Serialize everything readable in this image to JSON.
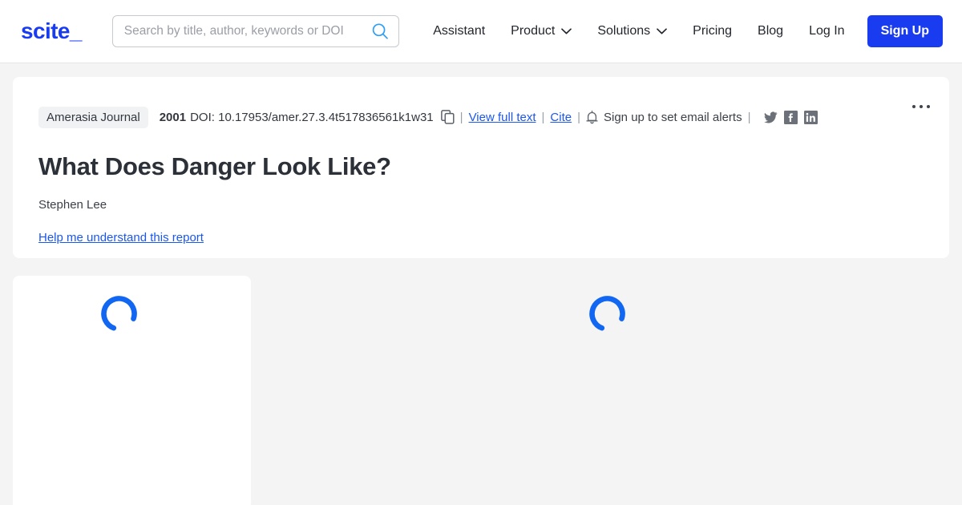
{
  "header": {
    "logo_text": "scite_",
    "search": {
      "placeholder": "Search by title, author, keywords or DOI",
      "value": "",
      "icon": "search-icon"
    },
    "nav": [
      {
        "label": "Assistant",
        "has_dropdown": false
      },
      {
        "label": "Product",
        "has_dropdown": true
      },
      {
        "label": "Solutions",
        "has_dropdown": true
      },
      {
        "label": "Pricing",
        "has_dropdown": false
      },
      {
        "label": "Blog",
        "has_dropdown": false
      },
      {
        "label": "Log In",
        "has_dropdown": false
      }
    ],
    "signup_label": "Sign Up"
  },
  "paper": {
    "journal": "Amerasia Journal",
    "year": "2001",
    "doi_label": "DOI: 10.17953/amer.27.3.4t517836561k1w31",
    "copy_icon": "copy-icon",
    "view_full_text_label": "View full text",
    "cite_label": "Cite",
    "bell_icon": "bell-icon",
    "alerts_label": "Sign up to set email alerts",
    "separator": "|",
    "socials": [
      {
        "name": "twitter-icon",
        "label": "Twitter"
      },
      {
        "name": "facebook-icon",
        "label": "Facebook"
      },
      {
        "name": "linkedin-icon",
        "label": "LinkedIn"
      }
    ],
    "title": "What Does Danger Look Like?",
    "authors": "Stephen Lee",
    "help_link_label": "Help me understand this report",
    "more_menu": "more-options"
  },
  "loading": {
    "sidebar_spinner": "loading-spinner",
    "main_spinner": "loading-spinner"
  },
  "colors": {
    "brand_blue": "#1a3cf0",
    "link_blue": "#1a56f0",
    "spinner_blue": "#1267f2",
    "page_bg": "#f4f4f5",
    "panel_bg": "#ffffff",
    "text_dark": "#2c3038",
    "icon_gray": "#6b7079"
  }
}
